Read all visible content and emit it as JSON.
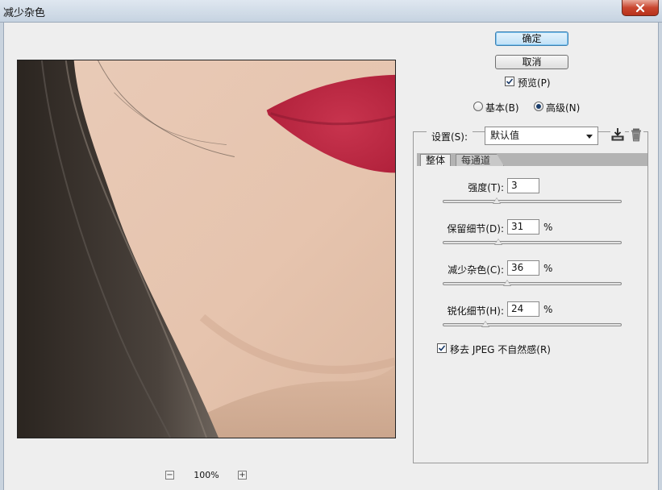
{
  "window": {
    "title": "减少杂色"
  },
  "buttons": {
    "ok": "确定",
    "cancel": "取消"
  },
  "preview_checkbox": {
    "label": "预览(P)",
    "checked": true
  },
  "mode": {
    "basic": "基本(B)",
    "advanced": "高级(N)",
    "selected": "advanced"
  },
  "settings": {
    "label": "设置(S):",
    "value": "默认值"
  },
  "tabs": [
    "整体",
    "每通道"
  ],
  "params": [
    {
      "label": "强度(T):",
      "value": "3",
      "unit": "",
      "fraction": 0.3
    },
    {
      "label": "保留细节(D):",
      "value": "31",
      "unit": "%",
      "fraction": 0.31
    },
    {
      "label": "减少杂色(C):",
      "value": "36",
      "unit": "%",
      "fraction": 0.36
    },
    {
      "label": "锐化细节(H):",
      "value": "24",
      "unit": "%",
      "fraction": 0.24
    }
  ],
  "jpeg_checkbox": {
    "label": "移去 JPEG 不自然感(R)",
    "checked": true
  },
  "zoom": {
    "level": "100%",
    "minus": "−",
    "plus": "+"
  },
  "icons": {
    "close": "close-icon",
    "save": "save-preset-icon",
    "trash": "trash-icon"
  }
}
